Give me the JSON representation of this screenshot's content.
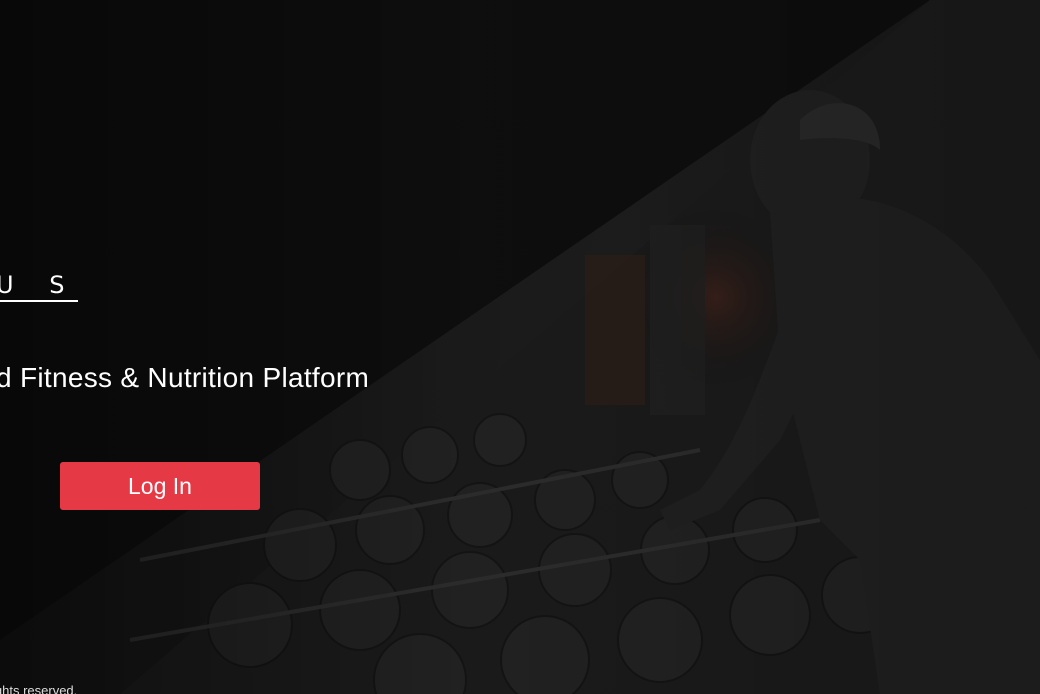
{
  "brand": {
    "logo_text": "U S"
  },
  "hero": {
    "tagline": "d Fitness & Nutrition Platform"
  },
  "actions": {
    "login_label": "Log In"
  },
  "footer": {
    "copyright": "ights reserved."
  },
  "colors": {
    "accent": "#e63946",
    "background": "#121212",
    "text": "#ffffff"
  }
}
